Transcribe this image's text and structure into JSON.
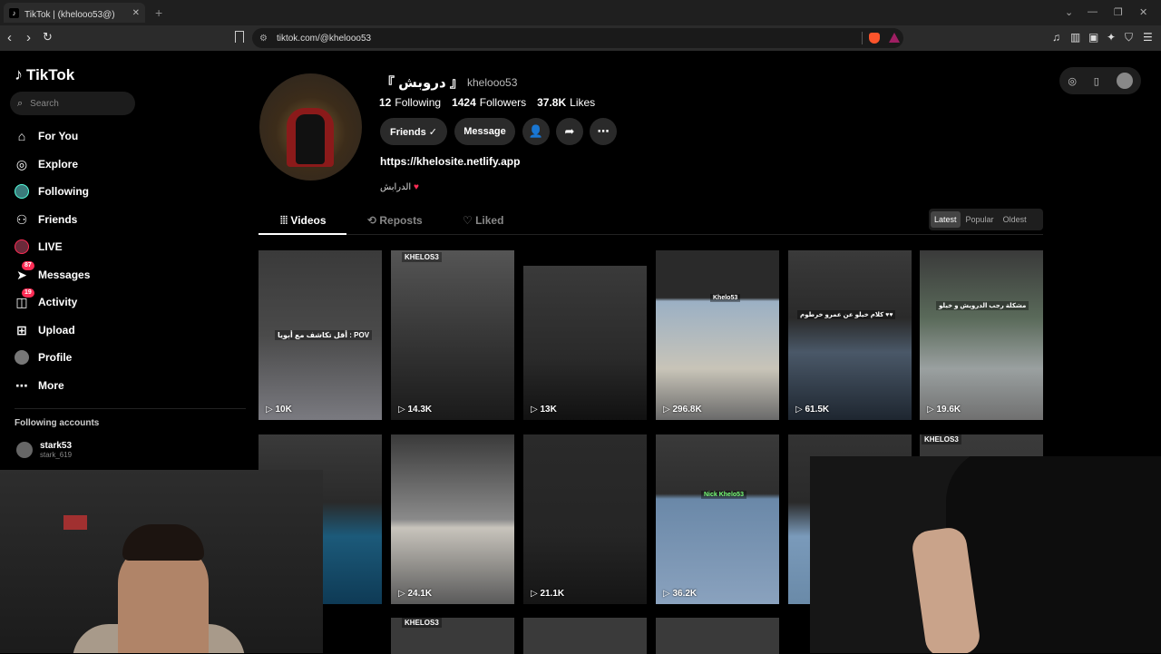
{
  "browser": {
    "tab_title": "TikTok | (khelooo53@) 『 دروبش 』",
    "tab_close": "✕",
    "new_tab": "+",
    "url": "tiktok.com/@khelooo53",
    "window_controls": [
      "⌄",
      "—",
      "❐",
      "✕"
    ]
  },
  "sidebar": {
    "logo": "TikTok",
    "search_placeholder": "Search",
    "items": [
      {
        "label": "For You",
        "icon": "home-icon"
      },
      {
        "label": "Explore",
        "icon": "compass-icon"
      },
      {
        "label": "Following",
        "icon": "following-avatar-icon"
      },
      {
        "label": "Friends",
        "icon": "friends-icon"
      },
      {
        "label": "LIVE",
        "icon": "live-icon"
      },
      {
        "label": "Messages",
        "icon": "messages-icon",
        "badge": "87"
      },
      {
        "label": "Activity",
        "icon": "activity-icon",
        "badge": "19"
      },
      {
        "label": "Upload",
        "icon": "upload-icon"
      },
      {
        "label": "Profile",
        "icon": "profile-icon"
      },
      {
        "label": "More",
        "icon": "more-icon"
      }
    ],
    "following_title": "Following accounts",
    "following_accounts": [
      {
        "name": "stark53",
        "handle": "stark_619"
      }
    ]
  },
  "profile": {
    "display_name": "『 دروبش 』",
    "handle": "khelooo53",
    "following_count": "12",
    "following_label": "Following",
    "followers_count": "1424",
    "followers_label": "Followers",
    "likes_count": "37.8K",
    "likes_label": "Likes",
    "friends_button": "Friends ✓",
    "message_button": "Message",
    "link": "https://khelosite.netlify.app",
    "bio": "الدرابش",
    "bio_emoji": "♥"
  },
  "tabs": {
    "videos": "Videos",
    "reposts": "Reposts",
    "liked": "Liked"
  },
  "sort": {
    "latest": "Latest",
    "popular": "Popular",
    "oldest": "Oldest"
  },
  "videos": [
    {
      "views": "10K",
      "caption": "أقل تكاشف مع أبويا : POV"
    },
    {
      "views": "14.3K",
      "caption": "KHELOS3"
    },
    {
      "views": "13K",
      "caption": ""
    },
    {
      "views": "296.8K",
      "caption": "Khelo53"
    },
    {
      "views": "61.5K",
      "caption": "كلام خيلو عن عمرو خرطوم ♥♥"
    },
    {
      "views": "19.6K",
      "caption": "مشكلة رجب الدرويش و خيلو"
    },
    {
      "views": "",
      "caption": ""
    },
    {
      "views": "",
      "caption": ""
    },
    {
      "views": "21.1K",
      "caption": ""
    },
    {
      "views": "36.2K",
      "caption": "Nick Khelo53"
    },
    {
      "views": "",
      "caption": ""
    },
    {
      "views": "",
      "caption": "KHELOS3"
    },
    {
      "views": "24.1K",
      "caption": ""
    }
  ],
  "bottom_row_captions": [
    "KHELOS3"
  ]
}
